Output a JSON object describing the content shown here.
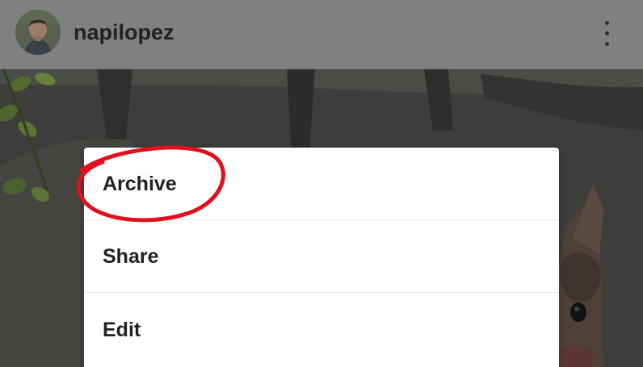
{
  "header": {
    "username": "napilopez",
    "avatar_icon": "profile-avatar",
    "more_icon": "vertical-ellipsis-icon"
  },
  "photo": {
    "background_color": "#3f403d"
  },
  "menu": {
    "items": [
      {
        "label": "Archive",
        "highlighted": true
      },
      {
        "label": "Share"
      },
      {
        "label": "Edit"
      }
    ]
  },
  "colors": {
    "header_overlay": "#808080",
    "menu_background": "#ffffff",
    "menu_text": "#222222",
    "highlight_annotation": "#e0101c"
  }
}
